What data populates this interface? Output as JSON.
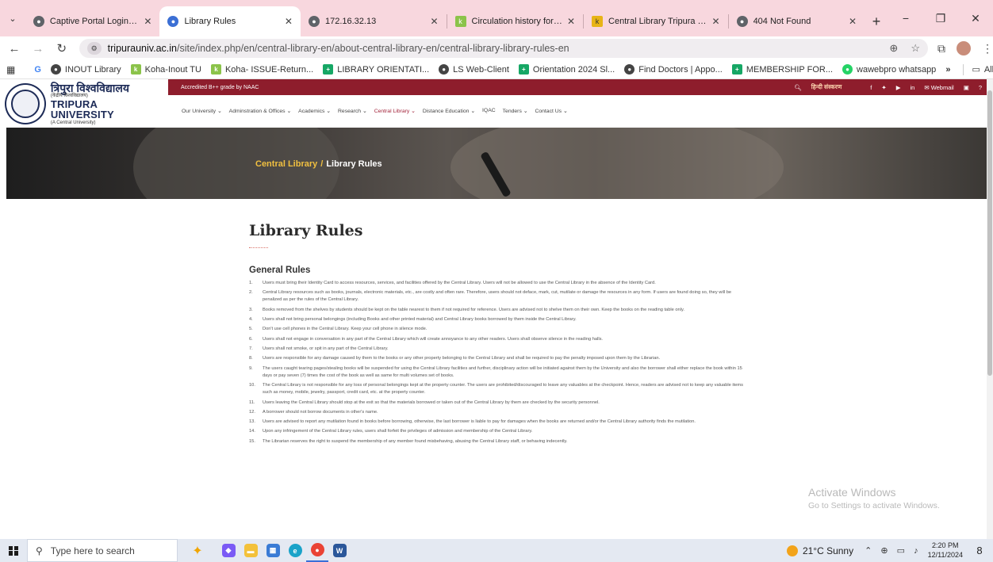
{
  "browser": {
    "tabs": [
      {
        "title": "Captive Portal Login Page",
        "icon": "globe-icon",
        "color": "#5f6368"
      },
      {
        "title": "Library Rules",
        "icon": "tripura-favicon",
        "color": "#3b6fd4"
      },
      {
        "title": "172.16.32.13",
        "icon": "globe-icon",
        "color": "#5f6368"
      },
      {
        "title": "Circulation history for Dr Sw",
        "icon": "koha-icon",
        "color": "#8bc34a"
      },
      {
        "title": "Central Library Tripura Unive",
        "icon": "koha-k-icon",
        "color": "#e7b416"
      },
      {
        "title": "404 Not Found",
        "icon": "globe-icon",
        "color": "#5f6368"
      }
    ],
    "new_tab": "+",
    "url_host": "tripurauniv.ac.in",
    "url_path": "/site/index.php/en/central-library-en/about-central-library-en/central-library-library-rules-en",
    "bookmarks": [
      {
        "label": "INOUT Library",
        "icon": "globe-icon",
        "color": "#444444"
      },
      {
        "label": "Koha-Inout TU",
        "icon": "koha-icon",
        "color": "#8bc34a"
      },
      {
        "label": "Koha- ISSUE-Return...",
        "icon": "koha-icon",
        "color": "#8bc34a"
      },
      {
        "label": "LIBRARY ORIENTATI...",
        "icon": "plus-icon",
        "color": "#16a765"
      },
      {
        "label": "LS Web-Client",
        "icon": "globe-icon",
        "color": "#444444"
      },
      {
        "label": "Orientation 2024 Sl...",
        "icon": "plus-icon",
        "color": "#16a765"
      },
      {
        "label": "Find Doctors | Appo...",
        "icon": "globe-icon",
        "color": "#444444"
      },
      {
        "label": "MEMBERSHIP FOR...",
        "icon": "plus-icon",
        "color": "#16a765"
      },
      {
        "label": "wawebpro whatsapp",
        "icon": "whatsapp-icon",
        "color": "#25d366"
      }
    ],
    "bookmarks_more": "»",
    "all_bookmarks": "All Bookmarks"
  },
  "site": {
    "logo_hindi": "त्रिपुरा विश्वविद्यालय",
    "logo_hindi_sub": "(केंद्रीय विश्वविद्यालय)",
    "logo_en": "TRIPURA UNIVERSITY",
    "logo_en_sub": "(A Central University)",
    "accreditation": "Accredited B++ grade by NAAC",
    "hindi_version": "हिन्दी संस्करण",
    "webmail": "Webmail",
    "nav": [
      {
        "label": "Our University",
        "active": false
      },
      {
        "label": "Adminstration & Offices",
        "active": false
      },
      {
        "label": "Academics",
        "active": false
      },
      {
        "label": "Research",
        "active": false
      },
      {
        "label": "Central Library",
        "active": true
      },
      {
        "label": "Distance Education",
        "active": false
      },
      {
        "label": "IQAC",
        "active": false
      },
      {
        "label": "Tenders",
        "active": false
      },
      {
        "label": "Contact Us",
        "active": false
      }
    ],
    "breadcrumb_parent": "Central Library",
    "breadcrumb_sep": "/",
    "breadcrumb_current": "Library Rules"
  },
  "content": {
    "title": "Library Rules",
    "section": "General Rules",
    "rules": [
      {
        "num": "1.",
        "text": "Users must bring their Identity Card to access resources, services, and facilities offered by the Central Library. Users will not be allowed to use the Central Library in the absence of the Identity Card."
      },
      {
        "num": "2.",
        "text": "Central Library resources such as books, journals, electronic materials, etc., are costly and often rare. Therefore, users should not deface, mark, cut, mutilate or damage the resources in any form. If users are found doing so, they will be penalized as per the rules of the Central Library."
      },
      {
        "num": "3.",
        "text": "Books removed from the shelves by students should be kept on the table nearest to them if not required for reference. Users are advised not to shelve them on their own. Keep the books on the reading table only."
      },
      {
        "num": "4.",
        "text": "Users shall not bring personal belongings (including Books and other printed material) and Central Library books borrowed by them inside the Central Library."
      },
      {
        "num": "5.",
        "text": "Don't use cell phones in the Central Library. Keep your cell phone in silence mode."
      },
      {
        "num": "6.",
        "text": "Users shall not engage in conversation in any part of the Central Library which will create annoyance to any other readers. Users shall observe silence in the reading halls."
      },
      {
        "num": "7.",
        "text": "Users shall not smoke, or spit in any part of the Central Library."
      },
      {
        "num": "8.",
        "text": "Users are responsible for any damage caused by them to the books or any other property belonging to the Central Library and shall be required to pay the penalty imposed upon them by the Librarian."
      },
      {
        "num": "9.",
        "text": "The users caught tearing pages/stealing books will be suspended for using the Central Library facilities and further, disciplinary action will be initiated against them by the University and also the borrower shall either replace the book within 15 days or pay seven (7) times the cost of the book as well as same for multi volumes set of books."
      },
      {
        "num": "10.",
        "text": "The Central Library is not responsible for any loss of personal belongings kept at the property counter. The users are prohibited/discouraged to leave any valuables at the checkpoint. Hence, readers are advised not to keep any valuable items such as money, mobile, jewelry, passport, credit card, etc. at the property counter."
      },
      {
        "num": "11.",
        "text": "Users leaving the Central Library should stop at the exit so that the materials borrowed or taken out of the Central Library by them are checked by the security personnel."
      },
      {
        "num": "12.",
        "text": "A borrower should not borrow documents in other's name."
      },
      {
        "num": "13.",
        "text": "Users are advised to report any mutilation found in books before borrowing, otherwise, the last borrower is liable to pay for damages when the books are returned and/or the Central Library authority finds the mutilation."
      },
      {
        "num": "14.",
        "text": "Upon any infringement of the Central Library rules, users shall forfeit the privileges of admission and membership of the Central Library."
      },
      {
        "num": "15.",
        "text": "The Librarian reserves the right to suspend the membership of any member found misbehaving, abusing the Central Library staff, or behaving indecently."
      }
    ]
  },
  "watermark": {
    "line1": "Activate Windows",
    "line2": "Go to Settings to activate Windows."
  },
  "taskbar": {
    "search_placeholder": "Type here to search",
    "weather": "21°C  Sunny",
    "time": "2:20 PM",
    "date": "12/11/2024",
    "notifications": "8"
  }
}
